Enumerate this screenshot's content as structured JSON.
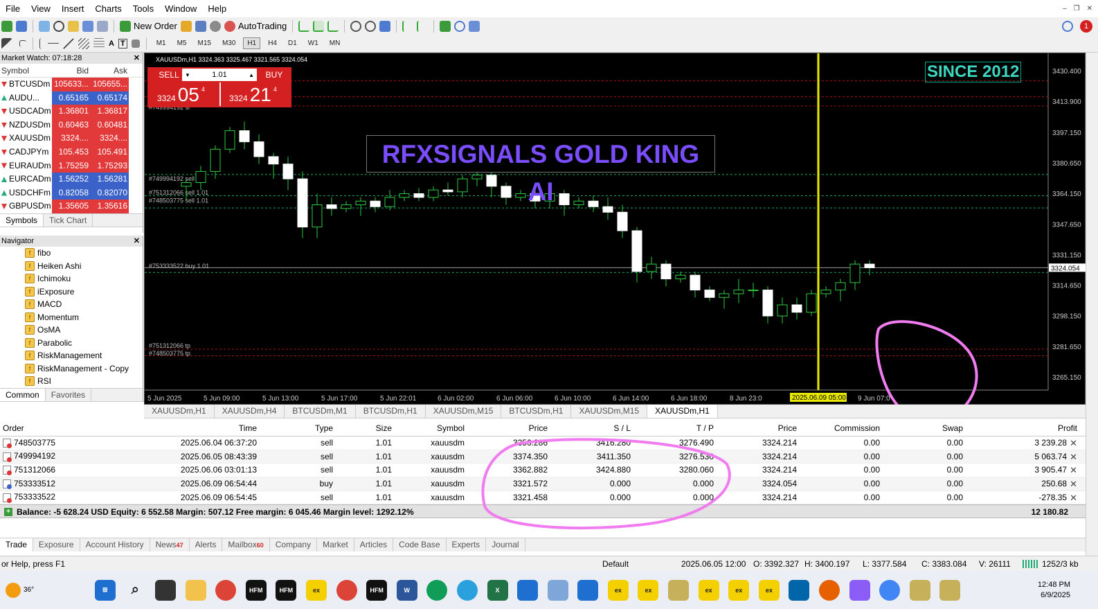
{
  "menu": [
    "File",
    "View",
    "Insert",
    "Charts",
    "Tools",
    "Window",
    "Help"
  ],
  "toolbar": {
    "new_order": "New Order",
    "autotrading": "AutoTrading",
    "timeframes": [
      "M1",
      "M5",
      "M15",
      "M30",
      "H1",
      "H4",
      "D1",
      "W1",
      "MN"
    ],
    "active_tf": "H1",
    "notification_count": "1"
  },
  "market_watch": {
    "title": "Market Watch: 07:18:28",
    "headers": {
      "symbol": "Symbol",
      "bid": "Bid",
      "ask": "Ask"
    },
    "rows": [
      {
        "symbol": "BTCUSDm",
        "bid": "105633...",
        "ask": "105655...",
        "dir": "dn"
      },
      {
        "symbol": "AUDU...",
        "bid": "0.65165",
        "ask": "0.65174",
        "dir": "up"
      },
      {
        "symbol": "USDCADm",
        "bid": "1.36801",
        "ask": "1.36817",
        "dir": "dn"
      },
      {
        "symbol": "NZDUSDm",
        "bid": "0.60463",
        "ask": "0.60481",
        "dir": "dn"
      },
      {
        "symbol": "XAUUSDm",
        "bid": "3324....",
        "ask": "3324....",
        "dir": "dn"
      },
      {
        "symbol": "CADJPYm",
        "bid": "105.453",
        "ask": "105.491",
        "dir": "dn"
      },
      {
        "symbol": "EURAUDm",
        "bid": "1.75259",
        "ask": "1.75293",
        "dir": "dn"
      },
      {
        "symbol": "EURCADm",
        "bid": "1.56252",
        "ask": "1.56281",
        "dir": "up"
      },
      {
        "symbol": "USDCHFm",
        "bid": "0.82058",
        "ask": "0.82070",
        "dir": "up"
      },
      {
        "symbol": "GBPUSDm",
        "bid": "1.35605",
        "ask": "1.35616",
        "dir": "dn"
      }
    ],
    "tabs": [
      "Symbols",
      "Tick Chart"
    ]
  },
  "navigator": {
    "title": "Navigator",
    "items": [
      "fibo",
      "Heiken Ashi",
      "Ichimoku",
      "iExposure",
      "MACD",
      "Momentum",
      "OsMA",
      "Parabolic",
      "RiskManagement",
      "RiskManagement - Copy",
      "RSI",
      "sar with fibo"
    ],
    "tabs": [
      "Common",
      "Favorites"
    ]
  },
  "chart": {
    "title": "XAUUSDm,H1  3324.363 3325.467 3321.565 3324.054",
    "sell_label": "SELL",
    "buy_label": "BUY",
    "lot": "1.01",
    "sell_price": {
      "small": "3324",
      "big": "05",
      "sup": "4"
    },
    "buy_price": {
      "small": "3324",
      "big": "21",
      "sup": "4"
    },
    "since_text": "SINCE 2012",
    "banner_text": "RFXSIGNALS GOLD KING AI",
    "price_labels": [
      "3430.400",
      "3413.900",
      "3397.150",
      "3380.650",
      "3364.150",
      "3347.650",
      "3331.150",
      "3314.650",
      "3298.150",
      "3281.650",
      "3265.150"
    ],
    "current_price": "3324.054",
    "time_labels": [
      "5 Jun 2025",
      "5 Jun 09:00",
      "5 Jun 13:00",
      "5 Jun 17:00",
      "5 Jun 22:01",
      "6 Jun 02:00",
      "6 Jun 06:00",
      "6 Jun 10:00",
      "6 Jun 14:00",
      "6 Jun 18:00",
      "8 Jun 23:0",
      "9 Jun 07:0"
    ],
    "crosshair_time": "2025.06.09 05:00",
    "level_labels": [
      "#749994192 sl",
      "#749994192 sell",
      "#751312066 sell 1.01",
      "#748503775 sell 1.01",
      "#753333522 buy 1.01",
      "#751312066 tp",
      "#748503775 tp"
    ]
  },
  "chart_tabs": [
    "XAUUSDm,H1",
    "XAUUSDm,H4",
    "BTCUSDm,M1",
    "BTCUSDm,H1",
    "XAUUSDm,M15",
    "BTCUSDm,H1",
    "XAUUSDm,M15",
    "XAUUSDm,H1"
  ],
  "trade": {
    "headers": {
      "order": "Order",
      "time": "Time",
      "type": "Type",
      "size": "Size",
      "symbol": "Symbol",
      "price": "Price",
      "sl": "S / L",
      "tp": "T / P",
      "cur": "Price",
      "comm": "Commission",
      "swap": "Swap",
      "profit": "Profit"
    },
    "rows": [
      {
        "order": "748503775",
        "time": "2025.06.04 06:37:20",
        "type": "sell",
        "size": "1.01",
        "symbol": "xauusdm",
        "price": "3356.286",
        "sl": "3416.280",
        "tp": "3276.490",
        "cur": "3324.214",
        "comm": "0.00",
        "swap": "0.00",
        "profit": "3 239.28"
      },
      {
        "order": "749994192",
        "time": "2025.06.05 08:43:39",
        "type": "sell",
        "size": "1.01",
        "symbol": "xauusdm",
        "price": "3374.350",
        "sl": "3411.350",
        "tp": "3276.530",
        "cur": "3324.214",
        "comm": "0.00",
        "swap": "0.00",
        "profit": "5 063.74"
      },
      {
        "order": "751312066",
        "time": "2025.06.06 03:01:13",
        "type": "sell",
        "size": "1.01",
        "symbol": "xauusdm",
        "price": "3362.882",
        "sl": "3424.880",
        "tp": "3280.060",
        "cur": "3324.214",
        "comm": "0.00",
        "swap": "0.00",
        "profit": "3 905.47"
      },
      {
        "order": "753333512",
        "time": "2025.06.09 06:54:44",
        "type": "buy",
        "size": "1.01",
        "symbol": "xauusdm",
        "price": "3321.572",
        "sl": "0.000",
        "tp": "0.000",
        "cur": "3324.054",
        "comm": "0.00",
        "swap": "0.00",
        "profit": "250.68"
      },
      {
        "order": "753333522",
        "time": "2025.06.09 06:54:45",
        "type": "sell",
        "size": "1.01",
        "symbol": "xauusdm",
        "price": "3321.458",
        "sl": "0.000",
        "tp": "0.000",
        "cur": "3324.214",
        "comm": "0.00",
        "swap": "0.00",
        "profit": "-278.35"
      }
    ],
    "balance_line": "Balance: -5 628.24 USD  Equity: 6 552.58  Margin: 507.12  Free margin: 6 045.46  Margin level: 1292.12%",
    "total_profit": "12 180.82"
  },
  "term_tabs": [
    {
      "label": "Trade",
      "badge": ""
    },
    {
      "label": "Exposure",
      "badge": ""
    },
    {
      "label": "Account History",
      "badge": ""
    },
    {
      "label": "News",
      "badge": "47"
    },
    {
      "label": "Alerts",
      "badge": ""
    },
    {
      "label": "Mailbox",
      "badge": "60"
    },
    {
      "label": "Company",
      "badge": ""
    },
    {
      "label": "Market",
      "badge": ""
    },
    {
      "label": "Articles",
      "badge": ""
    },
    {
      "label": "Code Base",
      "badge": ""
    },
    {
      "label": "Experts",
      "badge": ""
    },
    {
      "label": "Journal",
      "badge": ""
    }
  ],
  "status": {
    "help": "or Help, press F1",
    "profile": "Default",
    "datetime": "2025.06.05 12:00",
    "o": "O: 3392.327",
    "h": "H: 3400.197",
    "l": "L: 3377.584",
    "c": "C: 3383.084",
    "v": "V: 26111",
    "traffic": "1252/3 kb"
  },
  "taskbar": {
    "weather": "36°",
    "time": "12:48 PM",
    "date": "6/9/2025"
  }
}
